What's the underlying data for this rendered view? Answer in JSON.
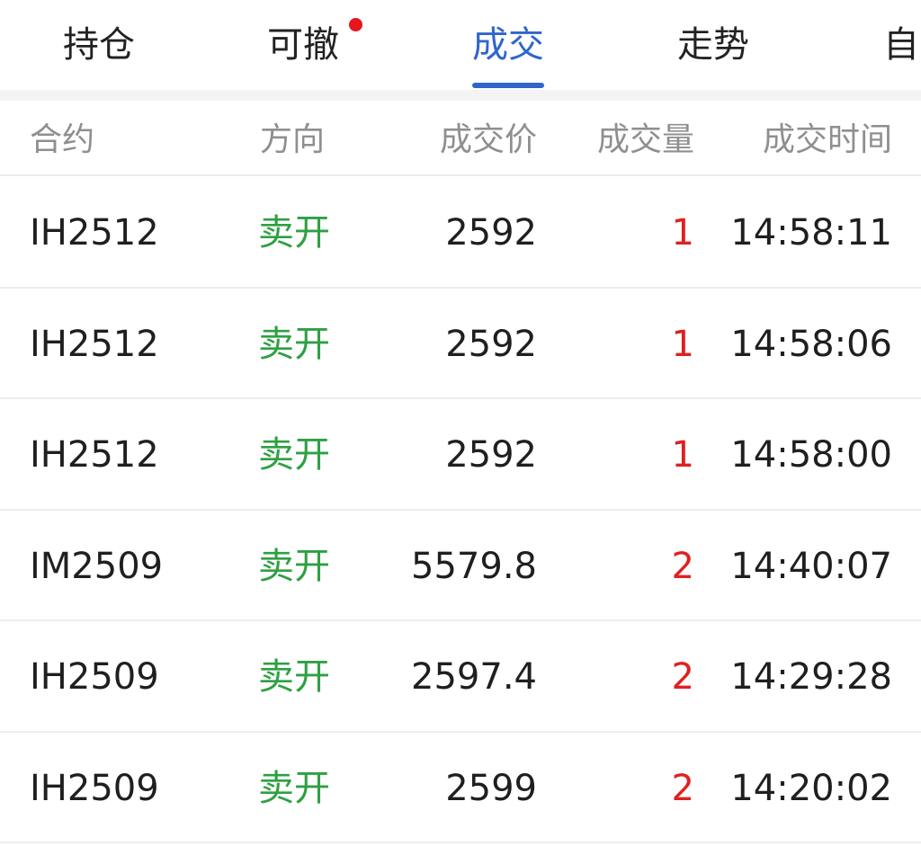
{
  "tabs": [
    {
      "label": "持仓",
      "active": false,
      "badge": false
    },
    {
      "label": "可撤",
      "active": false,
      "badge": true
    },
    {
      "label": "成交",
      "active": true,
      "badge": false
    },
    {
      "label": "走势",
      "active": false,
      "badge": false
    },
    {
      "label": "自",
      "active": false,
      "badge": false
    }
  ],
  "table": {
    "headers": {
      "contract": "合约",
      "direction": "方向",
      "price": "成交价",
      "quantity": "成交量",
      "time": "成交时间"
    },
    "rows": [
      {
        "contract": "IH2512",
        "direction": "卖开",
        "price": "2592",
        "quantity": "1",
        "time": "14:58:11"
      },
      {
        "contract": "IH2512",
        "direction": "卖开",
        "price": "2592",
        "quantity": "1",
        "time": "14:58:06"
      },
      {
        "contract": "IH2512",
        "direction": "卖开",
        "price": "2592",
        "quantity": "1",
        "time": "14:58:00"
      },
      {
        "contract": "IM2509",
        "direction": "卖开",
        "price": "5579.8",
        "quantity": "2",
        "time": "14:40:07"
      },
      {
        "contract": "IH2509",
        "direction": "卖开",
        "price": "2597.4",
        "quantity": "2",
        "time": "14:29:28"
      },
      {
        "contract": "IH2509",
        "direction": "卖开",
        "price": "2599",
        "quantity": "2",
        "time": "14:20:02"
      }
    ]
  },
  "colors": {
    "accent": "#2f66c9",
    "sell": "#2ea043",
    "quantity": "#e02020",
    "badge": "#e8141e"
  }
}
